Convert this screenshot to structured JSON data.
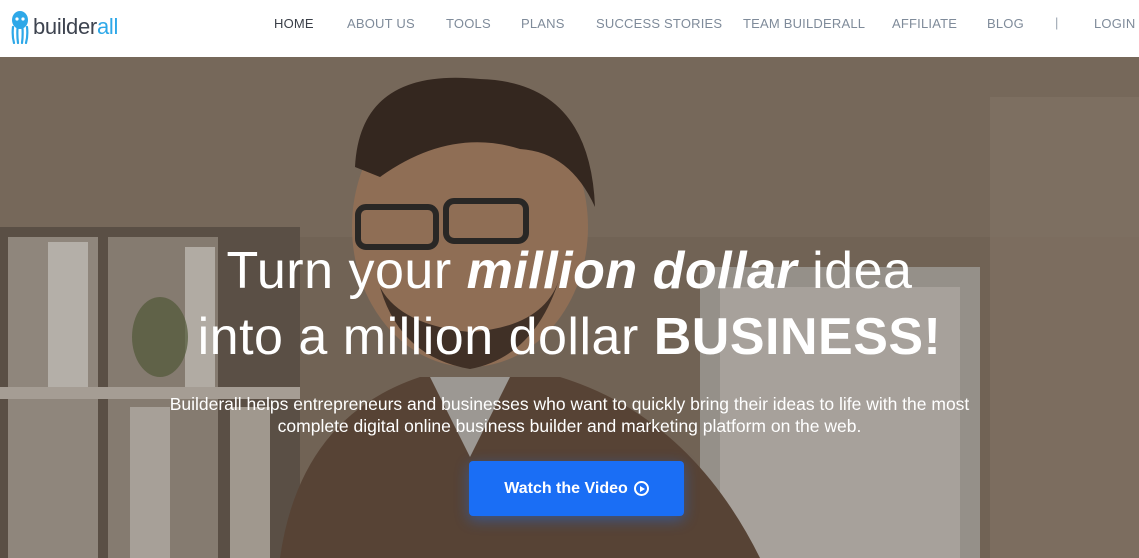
{
  "logo": {
    "part1": "builder",
    "part2": "all"
  },
  "nav": {
    "home": "HOME",
    "about": "ABOUT US",
    "tools": "TOOLS",
    "plans": "PLANS",
    "success": "SUCCESS STORIES",
    "team": "TEAM BUILDERALL",
    "affiliate": "AFFILIATE",
    "blog": "BLOG",
    "separator": "|",
    "login": "LOGIN"
  },
  "hero": {
    "line1_a": "Turn your ",
    "line1_em": "million dollar",
    "line1_b": " idea",
    "line2_a": "into a million dollar ",
    "line2_strong": "BUSINESS!",
    "sub_line1": "Builderall helps entrepreneurs and businesses who want to quickly bring their ideas to life with the most",
    "sub_line2": "complete digital online business builder and marketing platform on the web.",
    "cta_label": "Watch the Video"
  },
  "icons": {
    "logo": "octopus-logo-icon",
    "cta": "play-circle-icon"
  },
  "colors": {
    "brand_blue": "#2ea8e8",
    "cta_blue": "#1a6ef5",
    "nav_text": "#7f8b9a",
    "nav_active": "#3a3f48"
  }
}
